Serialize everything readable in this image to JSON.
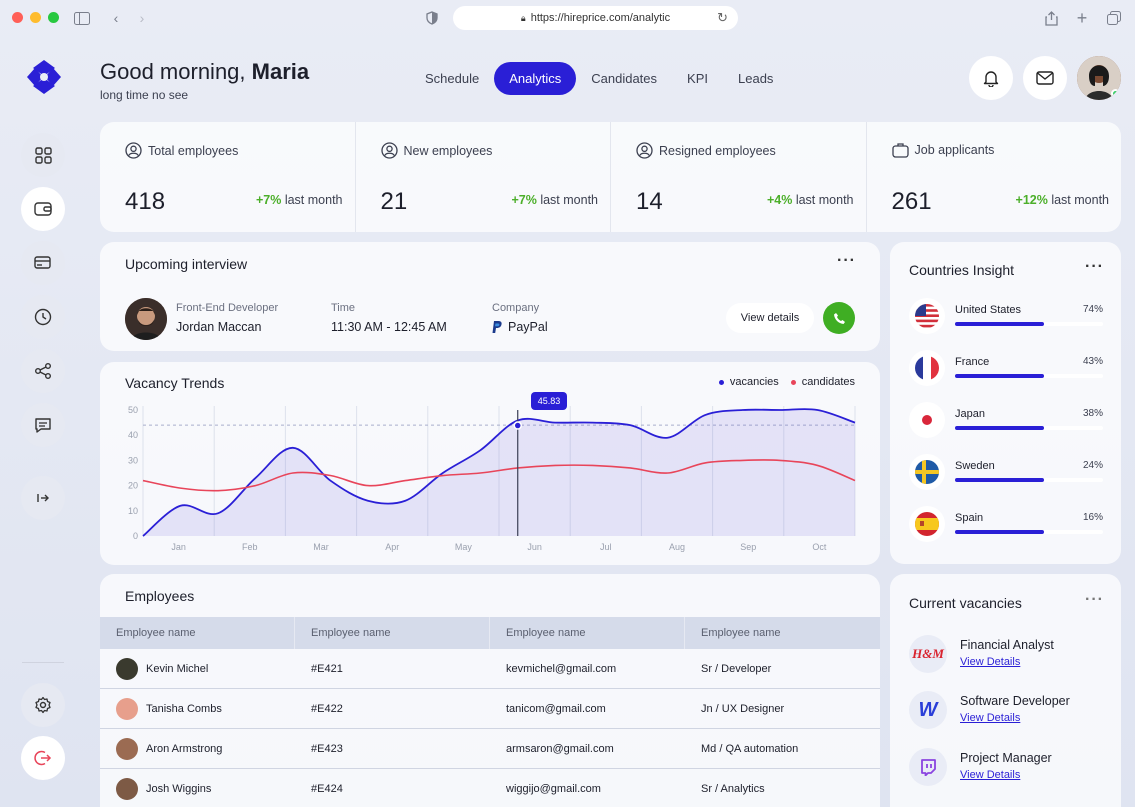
{
  "browser": {
    "url": "https://hireprice.com/analytic"
  },
  "header": {
    "greeting": "Good morning,",
    "user_name": "Maria",
    "subtitle": "long time no see",
    "nav": [
      {
        "label": "Schedule"
      },
      {
        "label": "Analytics",
        "active": true
      },
      {
        "label": "Candidates"
      },
      {
        "label": "KPI"
      },
      {
        "label": "Leads"
      }
    ]
  },
  "stats": [
    {
      "label": "Total employees",
      "value": "418",
      "change": "+7%",
      "suffix": "last month",
      "icon": "user-circle-icon"
    },
    {
      "label": "New employees",
      "value": "21",
      "change": "+7%",
      "suffix": "last month",
      "icon": "user-circle-icon"
    },
    {
      "label": "Resigned employees",
      "value": "14",
      "change": "+4%",
      "suffix": "last month",
      "icon": "user-circle-icon"
    },
    {
      "label": "Job applicants",
      "value": "261",
      "change": "+12%",
      "suffix": "last month",
      "icon": "briefcase-icon"
    }
  ],
  "interview": {
    "title": "Upcoming interview",
    "role_label": "Front-End Developer",
    "name": "Jordan Maccan",
    "time_label": "Time",
    "time": "11:30 AM - 12:45 AM",
    "company_label": "Company",
    "company": "PayPal",
    "view_button": "View details"
  },
  "chart_data": {
    "type": "line",
    "title": "Vacancy Trends",
    "categories": [
      "Jan",
      "Feb",
      "Mar",
      "Apr",
      "May",
      "Jun",
      "Jul",
      "Aug",
      "Sep",
      "Oct"
    ],
    "ylim": [
      0,
      50
    ],
    "yticks": [
      "0",
      "10",
      "20",
      "30",
      "40",
      "50"
    ],
    "series": [
      {
        "name": "vacancies",
        "color": "#2a1fd6",
        "x": [
          0,
          0.5,
          1,
          1.5,
          2,
          2.5,
          3,
          3.5,
          4,
          4.5,
          5,
          5.5,
          6,
          6.5,
          7,
          7.5,
          8,
          8.5,
          9,
          9.5
        ],
        "values": [
          0,
          12,
          9,
          23,
          35,
          22,
          14,
          14,
          25,
          34,
          45.83,
          45,
          45,
          44,
          39,
          48,
          53,
          53,
          52,
          45
        ]
      },
      {
        "name": "candidates",
        "color": "#e8455a",
        "x": [
          0,
          0.5,
          1,
          1.5,
          2,
          2.5,
          3,
          3.5,
          4,
          4.5,
          5,
          5.5,
          6,
          6.5,
          7,
          7.5,
          8,
          8.5,
          9,
          9.5
        ],
        "values": [
          22,
          19,
          18,
          20,
          25,
          24,
          20,
          22,
          24,
          25,
          27,
          28,
          28,
          27,
          25,
          29,
          30,
          30,
          28,
          22
        ]
      }
    ],
    "highlight": {
      "x": 5,
      "value": "45.83"
    },
    "reference_line": 44
  },
  "employees": {
    "title": "Employees",
    "columns": [
      "Employee name",
      "Employee name",
      "Employee name",
      "Employee name"
    ],
    "rows": [
      {
        "name": "Kevin Michel",
        "id": "#E421",
        "email": "kevmichel@gmail.com",
        "role": "Sr / Developer",
        "avatar_color": "#3a3a2e"
      },
      {
        "name": "Tanisha Combs",
        "id": "#E422",
        "email": "tanicom@gmail.com",
        "role": "Jn / UX Designer",
        "avatar_color": "#e79f8c"
      },
      {
        "name": "Aron Armstrong",
        "id": "#E423",
        "email": "armsaron@gmail.com",
        "role": "Md / QA automation",
        "avatar_color": "#9b6b52"
      },
      {
        "name": "Josh Wiggins",
        "id": "#E424",
        "email": "wiggijo@gmail.com",
        "role": "Sr / Analytics",
        "avatar_color": "#7d5a45"
      }
    ]
  },
  "countries": {
    "title": "Countries Insight",
    "items": [
      {
        "name": "United States",
        "pct": "74%",
        "fill": 0.6,
        "flag": "us-flag-icon"
      },
      {
        "name": "France",
        "pct": "43%",
        "fill": 0.6,
        "flag": "fr-flag-icon"
      },
      {
        "name": "Japan",
        "pct": "38%",
        "fill": 0.6,
        "flag": "jp-flag-icon"
      },
      {
        "name": "Sweden",
        "pct": "24%",
        "fill": 0.6,
        "flag": "se-flag-icon"
      },
      {
        "name": "Spain",
        "pct": "16%",
        "fill": 0.6,
        "flag": "es-flag-icon"
      }
    ]
  },
  "vacancies": {
    "title": "Current vacancies",
    "items": [
      {
        "title": "Financial Analyst",
        "link": "View Details",
        "logo": "H&M"
      },
      {
        "title": "Software Developer",
        "link": "View Details",
        "logo": "W"
      },
      {
        "title": "Project Manager",
        "link": "View Details",
        "logo": "twitch-icon"
      }
    ]
  },
  "colors": {
    "accent": "#2a1fd6",
    "positive": "#4caf2a",
    "call": "#3fae23",
    "candidates": "#e8455a"
  }
}
